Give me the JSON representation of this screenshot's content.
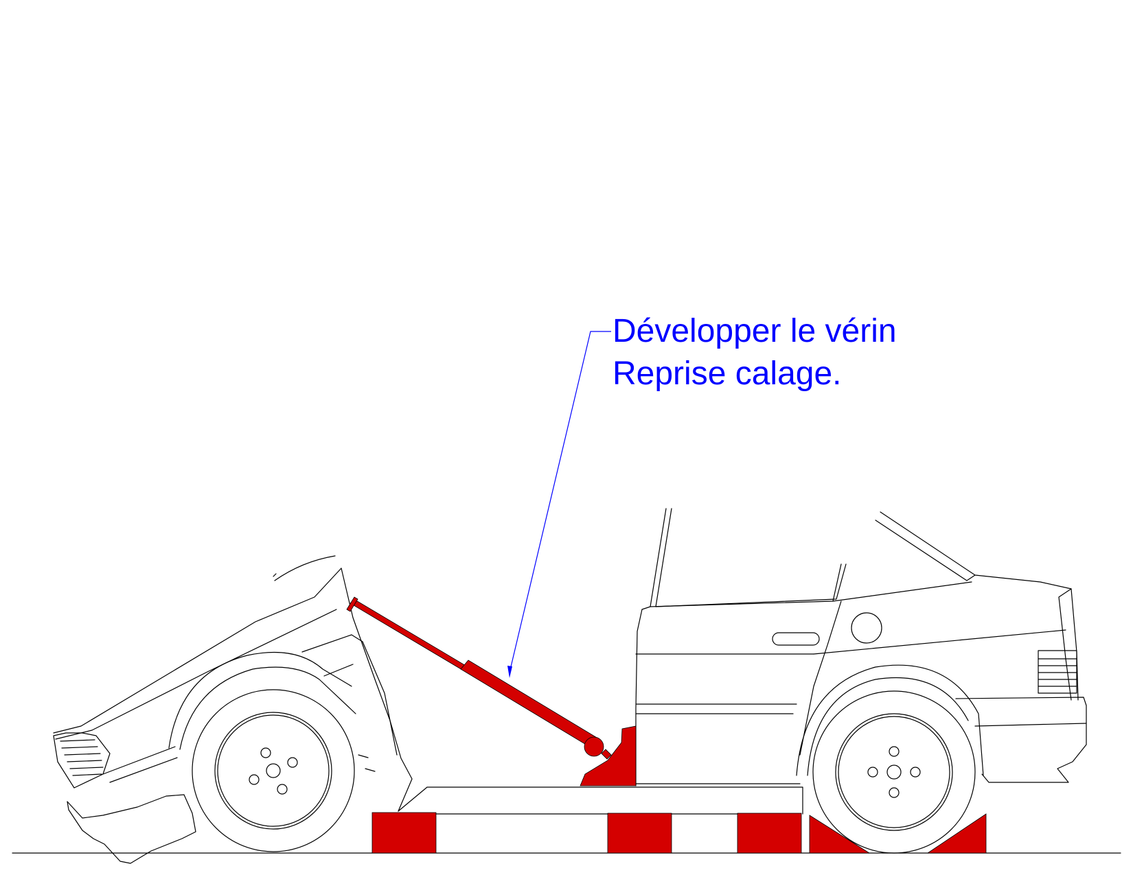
{
  "annotation": {
    "line1": "Développer le vérin",
    "line2": "Reprise calage.",
    "color": "#0000ff"
  },
  "colors": {
    "equipment": "#d40000",
    "outline": "#000000",
    "background": "#ffffff"
  }
}
